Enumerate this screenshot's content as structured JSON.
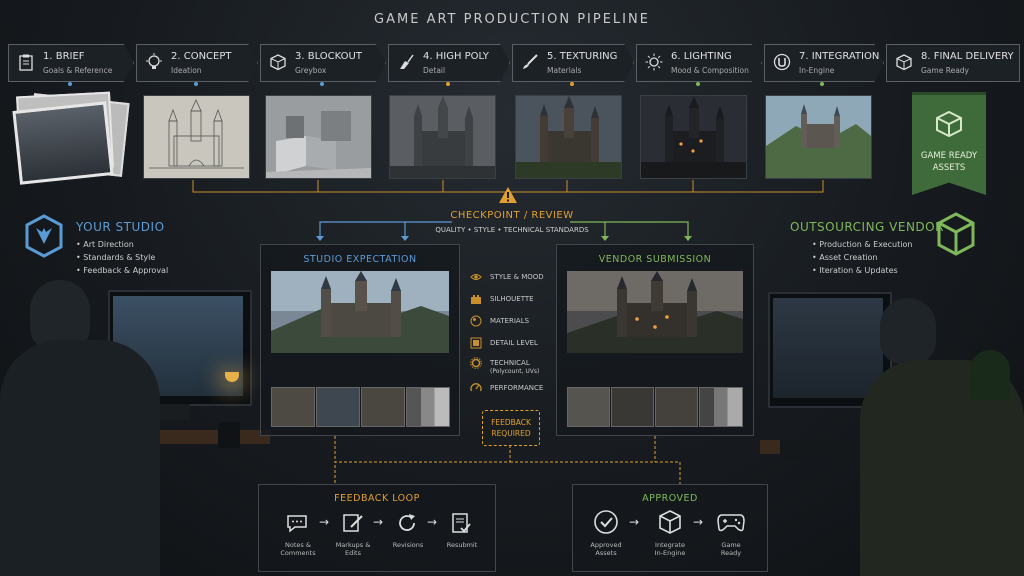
{
  "title": "GAME ART PRODUCTION PIPELINE",
  "stages": [
    {
      "name": "1. BRIEF",
      "sub": "Goals & Reference",
      "icon": "clipboard-icon"
    },
    {
      "name": "2. CONCEPT",
      "sub": "Ideation",
      "icon": "lightbulb-icon"
    },
    {
      "name": "3. BLOCKOUT",
      "sub": "Greybox",
      "icon": "cube-icon"
    },
    {
      "name": "4. HIGH POLY",
      "sub": "Detail",
      "icon": "sculpt-icon"
    },
    {
      "name": "5. TEXTURING",
      "sub": "Materials",
      "icon": "brush-icon"
    },
    {
      "name": "6. LIGHTING",
      "sub": "Mood & Composition",
      "icon": "sun-icon"
    },
    {
      "name": "7. INTEGRATION",
      "sub": "In-Engine",
      "icon": "engine-icon"
    },
    {
      "name": "8. FINAL DELIVERY",
      "sub": "Game Ready",
      "icon": "box-icon"
    }
  ],
  "banner": {
    "line1": "GAME READY",
    "line2": "ASSETS"
  },
  "checkpoint": {
    "title": "CHECKPOINT / REVIEW",
    "subtitle": "QUALITY • STYLE • TECHNICAL STANDARDS"
  },
  "studio": {
    "title": "YOUR STUDIO",
    "items": [
      "Art Direction",
      "Standards & Style",
      "Feedback & Approval"
    ]
  },
  "vendor": {
    "title": "OUTSOURCING VENDOR",
    "items": [
      "Production & Execution",
      "Asset Creation",
      "Iteration & Updates"
    ]
  },
  "studio_panel": {
    "title": "STUDIO EXPECTATION"
  },
  "vendor_panel": {
    "title": "VENDOR SUBMISSION"
  },
  "criteria": [
    {
      "label": "STYLE & MOOD",
      "icon": "eye-icon"
    },
    {
      "label": "SILHOUETTE",
      "icon": "castle-icon"
    },
    {
      "label": "MATERIALS",
      "icon": "materials-icon"
    },
    {
      "label": "DETAIL LEVEL",
      "icon": "detail-icon"
    },
    {
      "label": "TECHNICAL",
      "sub": "(Polycount, UVs)",
      "icon": "gear-icon"
    },
    {
      "label": "PERFORMANCE",
      "icon": "gauge-icon"
    }
  ],
  "feedback_required": {
    "line1": "FEEDBACK",
    "line2": "REQUIRED"
  },
  "feedback_loop": {
    "title": "FEEDBACK LOOP",
    "steps": [
      {
        "l1": "Notes &",
        "l2": "Comments",
        "icon": "chat-icon"
      },
      {
        "l1": "Markups &",
        "l2": "Edits",
        "icon": "pencil-icon"
      },
      {
        "l1": "Revisions",
        "l2": "",
        "icon": "refresh-icon"
      },
      {
        "l1": "Resubmit",
        "l2": "",
        "icon": "document-check-icon"
      }
    ]
  },
  "approved": {
    "title": "APPROVED",
    "steps": [
      {
        "l1": "Approved",
        "l2": "Assets",
        "icon": "check-circle-icon"
      },
      {
        "l1": "Integrate",
        "l2": "In-Engine",
        "icon": "cube-integrate-icon"
      },
      {
        "l1": "Game",
        "l2": "Ready",
        "icon": "gamepad-icon"
      }
    ]
  },
  "colors": {
    "blue": "#5b9bd5",
    "green": "#7fb85a",
    "gold": "#e0a030",
    "banner": "#3f6b3a"
  }
}
